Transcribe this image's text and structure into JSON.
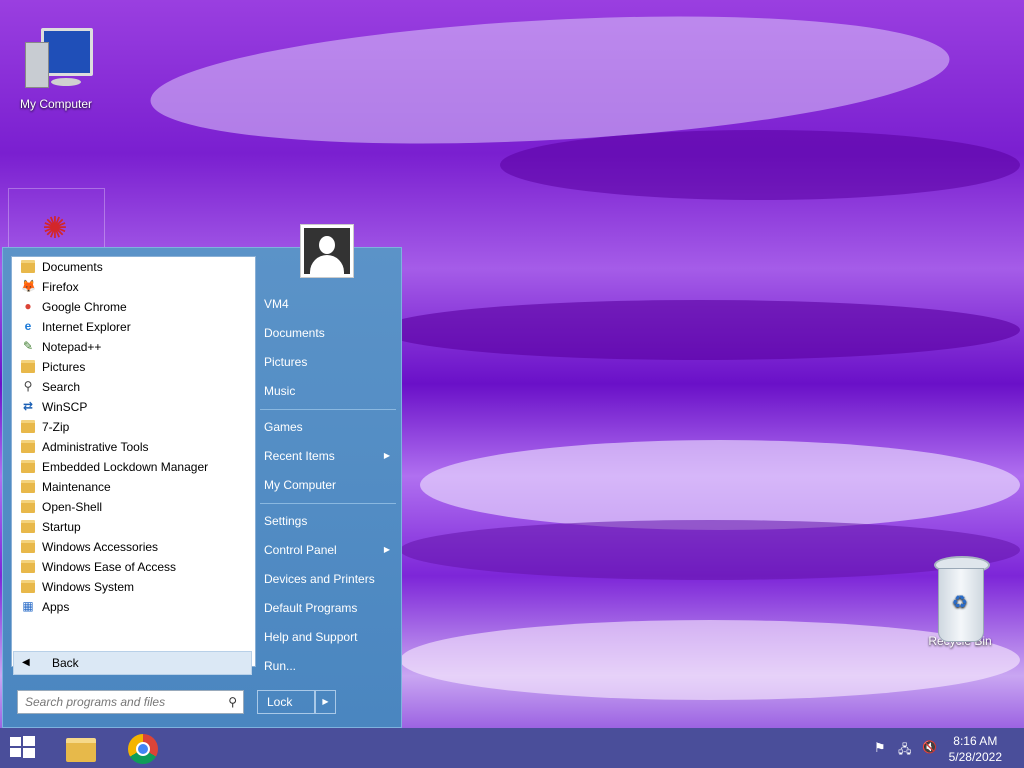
{
  "desktop": {
    "icons": [
      {
        "label": "My Computer"
      },
      {
        "label": "Recycle Bin"
      }
    ]
  },
  "start_menu": {
    "programs": [
      {
        "label": "Documents",
        "icon": "folder-docs-icon"
      },
      {
        "label": "Firefox",
        "icon": "firefox-icon"
      },
      {
        "label": "Google Chrome",
        "icon": "chrome-icon"
      },
      {
        "label": "Internet Explorer",
        "icon": "ie-icon"
      },
      {
        "label": "Notepad++",
        "icon": "notepad-icon"
      },
      {
        "label": "Pictures",
        "icon": "folder-pictures-icon"
      },
      {
        "label": "Search",
        "icon": "search-icon"
      },
      {
        "label": "WinSCP",
        "icon": "winscp-icon"
      },
      {
        "label": "7-Zip",
        "icon": "folder-icon"
      },
      {
        "label": "Administrative Tools",
        "icon": "folder-icon"
      },
      {
        "label": "Embedded Lockdown Manager",
        "icon": "folder-icon"
      },
      {
        "label": "Maintenance",
        "icon": "folder-icon"
      },
      {
        "label": "Open-Shell",
        "icon": "folder-icon"
      },
      {
        "label": "Startup",
        "icon": "folder-icon"
      },
      {
        "label": "Windows Accessories",
        "icon": "folder-icon"
      },
      {
        "label": "Windows Ease of Access",
        "icon": "folder-icon"
      },
      {
        "label": "Windows System",
        "icon": "folder-icon"
      },
      {
        "label": "Apps",
        "icon": "apps-icon"
      }
    ],
    "back_label": "Back",
    "search_placeholder": "Search programs and files",
    "right_links": {
      "user": "VM4",
      "documents": "Documents",
      "pictures": "Pictures",
      "music": "Music",
      "games": "Games",
      "recent_items": "Recent Items",
      "my_computer": "My Computer",
      "settings": "Settings",
      "control_panel": "Control Panel",
      "devices_printers": "Devices and Printers",
      "default_programs": "Default Programs",
      "help_support": "Help and Support",
      "run": "Run..."
    },
    "lock_label": "Lock"
  },
  "taskbar": {
    "time": "8:16 AM",
    "date": "5/28/2022"
  }
}
